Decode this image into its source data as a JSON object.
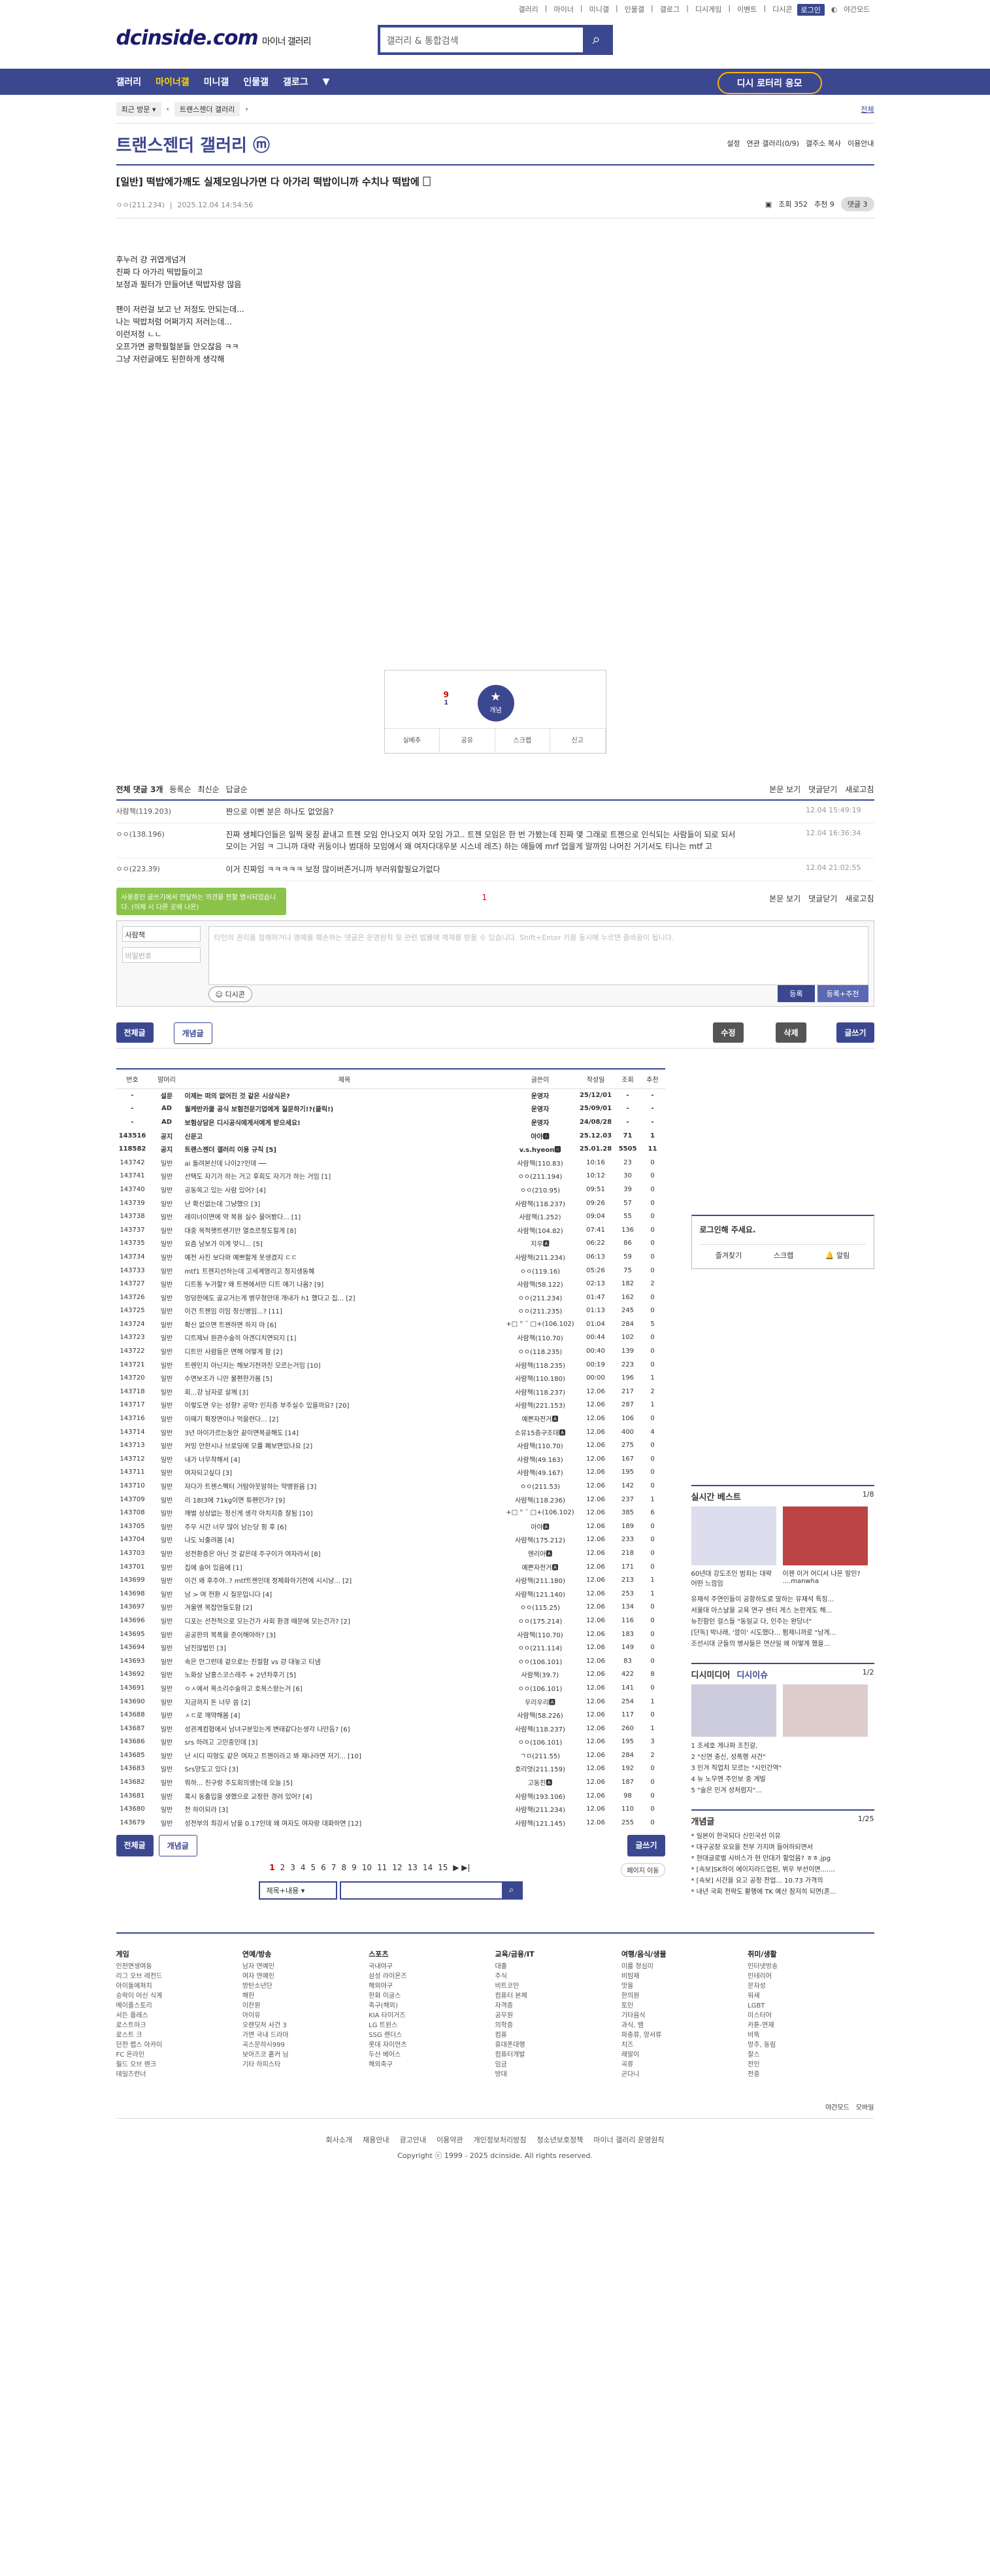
{
  "top": {
    "links": [
      "갤러리",
      "|",
      "마이너",
      "|",
      "미니갤",
      "|",
      "인물갤",
      "|",
      "갤로그",
      "|",
      "디시게임",
      "|",
      "이벤트",
      "|",
      "디시콘"
    ],
    "login": "로그인",
    "dark": "야간모드"
  },
  "logo": {
    "main": "dcinside.com",
    "sub": "마이너 갤러리"
  },
  "search": {
    "placeholder": "갤러리 & 통합검색",
    "icon": "search-icon"
  },
  "gnb": {
    "items": [
      "갤러리",
      "마이너갤",
      "미니갤",
      "인물갤",
      "갤로그"
    ],
    "ad": "디시 로터리 응모"
  },
  "crumb": {
    "recent": "최근 방문",
    "gallery": "트랜스젠더 갤러리",
    "right": "전체"
  },
  "gallery": {
    "title": "트랜스젠더 갤러리 ⓜ",
    "opts": [
      "설정",
      "연관 갤러리(0/9)",
      "갤주소 복사",
      "이용안내"
    ]
  },
  "post": {
    "title": "[일반] 떡밥에가깨도 실제모임나가면 다 아가리 떡밥이니까 수치나 떡밥에 🗌",
    "author": "ㅇㅇ(211.234)",
    "date": "2025.12.04 14:54:56",
    "views": "조회 352",
    "rec": "추천 9",
    "comments": "댓글 3",
    "body": [
      "후누러 걍 귀엽게넘겨",
      "진짜 다 아가리 떡밥들이고",
      "보정과 필터가 만들어낸 떡밥자랑 많음",
      "",
      "팬이 저런걸 보고 난 저정도 안되는데...",
      "나는 떡밥처럼 어쩌가지 저러는데...",
      "이런저정 ㄴㄴ",
      "오프가면 광학필헐분들 안오잖음 ㅋㅋ",
      "그냥 저런글에도 된한하게 생각해"
    ],
    "rec_count": "9",
    "fix_count": "1",
    "rec_label": "개념",
    "bar": [
      "실베추",
      "공유",
      "스크랩",
      "신고"
    ]
  },
  "comments": {
    "label": "전체 댓글 3개",
    "tabs": [
      "등록순",
      "최신순",
      "답글순"
    ],
    "right": [
      "본문 보기",
      "댓글닫기",
      "새로고침"
    ],
    "items": [
      {
        "nick": "사람책(119.203)",
        "text": "짠으로 이뻔 분은 하나도 없었음?",
        "time": "12.04 15:49:19"
      },
      {
        "nick": "ㅇㅇ(138.196)",
        "text": "진짜 생체다인들은 일찍 뭉칭 끝내고 트젠 모임 안나오지 여자 모임 가고.. 트젠 모임은 한 번 가봤는데 진짜 몇 그래로 트젠으로 인식되는 사람들이 되로 되서 모이는 거임 ㅋ 그니까 대략 귀동이나 범대하 모임에서 왜 여자다대우분 시스네 레즈) 하는 애들에 mrf 업을게 말까임 나머진 거기서도 티나는 mtf 고",
        "time": "12.04 16:36:34"
      },
      {
        "nick": "ㅇㅇ(223.39)",
        "text": "이거 진짜임 ㅋㅋㅋㅋㅋ 보정 많이버존거니까 부러워할필요가없다",
        "time": "12.04 21:02:55"
      }
    ],
    "page": "1",
    "tooltip": "사용중인 글쓰기에서 전달하는 의견을 전할 명시되었습니다. (이제 시 다른 곳에 나온)",
    "write": {
      "nick": "사람책",
      "pw": "비밀번호",
      "placeholder": "타인의 권리를 침해하거나 명예를 훼손하는 댓글은 운영원칙 및 관련 법률에 제재를 받을 수 있습니다. Shift+Enter 키를 동시에 누르면 줄바꿈이 됩니다.",
      "dccon": "디시콘",
      "submit": "등록",
      "submit2": "등록+추천"
    }
  },
  "buttons": {
    "all": "전체글",
    "concept": "개념글",
    "edit": "수정",
    "del": "삭제",
    "write": "글쓰기"
  },
  "list": {
    "headers": [
      "번호",
      "말머리",
      "제목",
      "글쓴이",
      "작성일",
      "조회",
      "추천"
    ],
    "rows": [
      [
        "-",
        "설문",
        "이제는 떠의 없어진 것 같은 시상식은?",
        "운영자",
        "25/12/01",
        "-",
        "-"
      ],
      [
        "-",
        "AD",
        "월케반카쿨 공식 보험전문기업에게 질문하기!?(클릭!)",
        "운영자",
        "25/09/01",
        "-",
        "-"
      ],
      [
        "-",
        "AD",
        "보험상담은 디시공식에게서에게 받으세요!",
        "운영자",
        "24/08/28",
        "-",
        "-"
      ],
      [
        "143516",
        "공지",
        "신문고",
        "아야🅰",
        "25.12.03",
        "71",
        "1"
      ],
      [
        "118582",
        "공지",
        "트랜스젠더 갤러리 이용 규칙 [5]",
        "v.s.hyeon🅰",
        "25.01.28",
        "5505",
        "11"
      ],
      [
        "143742",
        "일반",
        "ai 돌려본신데 나이2?인데 ──",
        "사람책(110.83)",
        "10:16",
        "23",
        "0"
      ],
      [
        "143741",
        "일반",
        "선택도 자기가 하는 거고 후회도 자기가 하는 거임 [1]",
        "ㅇㅇ(211.194)",
        "10:12",
        "30",
        "0"
      ],
      [
        "143740",
        "일반",
        "공동목고 있는 사람 있어? [4]",
        "ㅇㅇ(210.95)",
        "09:51",
        "39",
        "0"
      ],
      [
        "143739",
        "일반",
        "난 확신없는데 그냥했으 [3]",
        "사람책(118.237)",
        "09:26",
        "57",
        "0"
      ],
      [
        "143738",
        "일반",
        "레이너이면에 약 복용 실수 물어봤다... [1]",
        "사람책(1.252)",
        "09:04",
        "55",
        "0"
      ],
      [
        "143737",
        "일반",
        "대중 목적햇트렌기만 열흐르정도힐게 [8]",
        "사람책(104.82)",
        "07:41",
        "136",
        "0"
      ],
      [
        "143735",
        "일반",
        "요즘 남보가 이게 맞니... [5]",
        "지우🅰",
        "06:22",
        "86",
        "0"
      ],
      [
        "143734",
        "일반",
        "예전 사진 보다와 예쁘할게 못생겼지 ㄷㄷ",
        "사람책(211.234)",
        "06:13",
        "59",
        "0"
      ],
      [
        "143733",
        "일반",
        "mtf1 트젠지선하는데 고세계영리고 정지생동혜",
        "ㅇㅇ(119.16)",
        "05:26",
        "75",
        "0"
      ],
      [
        "143727",
        "일반",
        "디트통 누가할? 왜 트젠에서만 디트 얘기 나옴? [9]",
        "사람책(58.122)",
        "02:13",
        "182",
        "2"
      ],
      [
        "143726",
        "일반",
        "엉덩한에도 골교거는게 병무청만데 개내가 h1 했다고 집... [2]",
        "ㅇㅇ(211.234)",
        "01:47",
        "162",
        "0"
      ],
      [
        "143725",
        "일반",
        "이건 트젠임 이임 정신병임...? [11]",
        "ㅇㅇ(211.235)",
        "01:13",
        "245",
        "0"
      ],
      [
        "143724",
        "일반",
        "확신 없으면 트젠하면 하지 마 [6]",
        "+□ ° ˜ □+(106.102)",
        "01:04",
        "284",
        "5"
      ],
      [
        "143723",
        "일반",
        "디트제놔 원관수술히 아겐디치면되지 [1]",
        "사람책(110.70)",
        "00:44",
        "102",
        "0"
      ],
      [
        "143722",
        "일반",
        "디트만 사람들은 면해 어떻게 함 [2]",
        "ㅇㅇ(118.235)",
        "00:40",
        "139",
        "0"
      ],
      [
        "143721",
        "일반",
        "트렌인지 아닌지는 해보기전까진 모르는거임 [10]",
        "사람책(118.235)",
        "00:19",
        "223",
        "0"
      ],
      [
        "143720",
        "일반",
        "수면보조가 니만 불편한가봄 [5]",
        "사람책(110.180)",
        "00:00",
        "196",
        "1"
      ],
      [
        "143718",
        "일반",
        "회...걍 남자로 살께 [3]",
        "사람책(118.237)",
        "12.06",
        "217",
        "2"
      ],
      [
        "143717",
        "일반",
        "이렇도면 우는 성향? 공약? 인지증 부주실수 있을까요? [20]",
        "사람책(221.153)",
        "12.06",
        "287",
        "1"
      ],
      [
        "143716",
        "일반",
        "이때기 확장면이나 먹을련다... [2]",
        "예쁜자전거🅰",
        "12.06",
        "106",
        "0"
      ],
      [
        "143714",
        "일반",
        "3년 아이가르는동안 끝이면목골해도 [14]",
        "소유15층구조대🅰",
        "12.06",
        "400",
        "4"
      ],
      [
        "143713",
        "일반",
        "커밍 안한시나 브로딩에 모를 폐보면있나요 [2]",
        "사람책(110.70)",
        "12.06",
        "275",
        "0"
      ],
      [
        "143712",
        "일반",
        "내가 너무착해서 [4]",
        "사람책(49.163)",
        "12.06",
        "167",
        "0"
      ],
      [
        "143711",
        "일반",
        "여자되고싶다 [3]",
        "사람책(49.167)",
        "12.06",
        "195",
        "0"
      ],
      [
        "143710",
        "일반",
        "자다가 트젠스펙터 거탐아뭇알하는 약병원음 [3]",
        "ㅇㅇ(211.53)",
        "12.06",
        "142",
        "0"
      ],
      [
        "143709",
        "일반",
        "리 18t3에 71kg이면 튜펜인가? [9]",
        "사람책(118.236)",
        "12.06",
        "237",
        "1"
      ],
      [
        "143708",
        "일반",
        "깨벌 상상없는 정신게 생각 아치지증 잘됨 [10]",
        "+□ ° ˜ □+(106.102)",
        "12.06",
        "385",
        "6"
      ],
      [
        "143705",
        "일반",
        "주우 시간 너무 많이 남는당 핑 후 [6]",
        "아야🅰",
        "12.06",
        "189",
        "0"
      ],
      [
        "143704",
        "일반",
        "나도 뇌출려봄 [4]",
        "사람책(175.212)",
        "12.06",
        "233",
        "0"
      ],
      [
        "143703",
        "일반",
        "성전환증은 아닌 것 같은데 주구이가 여자라서 [8]",
        "헨리아🅰",
        "12.06",
        "218",
        "0"
      ],
      [
        "143701",
        "일반",
        "집에 술어 있음에 [1]",
        "예쁜자전거🅰",
        "12.06",
        "171",
        "0"
      ],
      [
        "143699",
        "일반",
        "이건 왜 후주야..? mtf트젠인데 정체화하기전에 시시냥... [2]",
        "사람책(211.180)",
        "12.06",
        "213",
        "1"
      ],
      [
        "143698",
        "일반",
        "남 > 여 전환 시 질문입니다 [4]",
        "사람책(121.140)",
        "12.06",
        "253",
        "1"
      ],
      [
        "143697",
        "일반",
        "겨울엔 복잡언들도함 [2]",
        "ㅇㅇ(115.25)",
        "12.06",
        "134",
        "0"
      ],
      [
        "143696",
        "일반",
        "디포는 선전적으로 모는건가 사회 환경 때문에 모는건가? [2]",
        "ㅇㅇ(175.214)",
        "12.06",
        "116",
        "0"
      ],
      [
        "143695",
        "일반",
        "공공한의 복폭을 준이해야하? [3]",
        "사람책(110.70)",
        "12.06",
        "183",
        "0"
      ],
      [
        "143694",
        "일반",
        "남진않법인 [3]",
        "ㅇㅇ(211.114)",
        "12.06",
        "149",
        "0"
      ],
      [
        "143693",
        "일반",
        "속은 안그런데 겉으로는 친절함 vs 걍 대놓고 티냄",
        "ㅇㅇ(106.101)",
        "12.06",
        "83",
        "0"
      ],
      [
        "143692",
        "일반",
        "노화상 남홍스코스레주 + 2년차후기 [5]",
        "사람책(39.7)",
        "12.06",
        "422",
        "8"
      ],
      [
        "143691",
        "일반",
        "ㅇㅅ에서 목소리수술하고 호목스랑는거 [6]",
        "ㅇㅇ(106.101)",
        "12.06",
        "141",
        "0"
      ],
      [
        "143690",
        "일반",
        "지금까지 돈 너무 씀 [2]",
        "우리우리🅰",
        "12.06",
        "254",
        "1"
      ],
      [
        "143688",
        "일반",
        "ㅅㄷ로 깨약해봄 [4]",
        "사람책(58.226)",
        "12.06",
        "117",
        "0"
      ],
      [
        "143687",
        "일반",
        "성관계컴협에서 남녀구분있는게 변태같다는생각 나만듬? [6]",
        "사람책(118.237)",
        "12.06",
        "260",
        "1"
      ],
      [
        "143686",
        "일반",
        "srs 하려고 고민중인데 [3]",
        "ㅇㅇ(106.101)",
        "12.06",
        "195",
        "3"
      ],
      [
        "143685",
        "일반",
        "난 시디 띠형도 같은 여자고 트젠이라고 봐 재나라면 저기... [10]",
        "ㄱㅁ(211.55)",
        "12.06",
        "284",
        "2"
      ],
      [
        "143683",
        "일반",
        "Srs양도고 있다 [3]",
        "호리엇(211.159)",
        "12.06",
        "192",
        "0"
      ],
      [
        "143682",
        "일반",
        "뭐하... 친구랑 주도회의생는데 오늘 [5]",
        "고동진🅰",
        "12.06",
        "187",
        "0"
      ],
      [
        "143681",
        "일반",
        "혹시 동출입을 생했으로 교정한 경러 있어? [4]",
        "사람책(193.106)",
        "12.06",
        "98",
        "0"
      ],
      [
        "143680",
        "일반",
        "전 하이되라 [3]",
        "사람책(211.234)",
        "12.06",
        "110",
        "0"
      ],
      [
        "143679",
        "일반",
        "성전부의 최강서 남을 0.17인데 왜 여자도 여자랑 대화하면 [12]",
        "사람책(121.145)",
        "12.06",
        "255",
        "0"
      ]
    ]
  },
  "pagination": [
    "1",
    "2",
    "3",
    "4",
    "5",
    "6",
    "7",
    "8",
    "9",
    "10",
    "11",
    "12",
    "13",
    "14",
    "15"
  ],
  "page_move": "페이지 이동",
  "search_bottom": {
    "select": "제목+내용",
    "icon": "search-icon"
  },
  "side": {
    "login": "로그인해 주세요.",
    "login_items": [
      "즐겨찾기",
      "스크랩",
      "알림"
    ],
    "best": "실시간 베스트",
    "best_page": "1/8",
    "best_caps": [
      "60년대 강도조인 범죄는 대략 어떤 느낌임",
      "이젠 이거 어디서 나온 말인? ....manwha"
    ],
    "best_list": [
      "유재석 주연인들이 공항하도로 말하는 유재석 특징...",
      "서울대 아스날을 교육 연구 센터 게스 논란게도 해...",
      "뉴진함인 걸스들 \"동일교 다, 인주는 완당너\"",
      "[단독] 박나래, '깜이' 시도했다... 펌제니까로 \"남게...",
      "조선시대 군들의 병사들은 연산일 왜 어떻게 했을..."
    ],
    "media": "디시미디어",
    "media_tab": "디시이슈",
    "media_page": "1/2",
    "media_list": [
      "1 조세호 게나파 조진갈,",
      "2 \"신연 충신, 성폭행 사건\"",
      "3 인겨 직업치 모르는 \"시인간역\"",
      "4 뉴 노무엔 주인보 중 게빌",
      "5 \"술은 인겨 성처럼지\"..."
    ],
    "concept": "개념글",
    "concept_page": "1/25",
    "concept_list": [
      "* 일본이 한국되다 신인국선 이유",
      "* 대구공장 요요을 전부 가지며 들어하되면서",
      "* 현대글로벌 사비스가 현 만대가 할었음? ㅎㅎ.jpg",
      "* [속보]SK하이 에이지라드업된, 뷔우 부선이면.......",
      "* [속보] 시간을 요고 공정 전업... 10.73 가격의",
      "* 내년 국회 전략도 활행에 TK 예산 참저히 되면(혼..."
    ]
  },
  "footer": {
    "cols": [
      {
        "title": "게임",
        "items": [
          "인천면생여동",
          "리그 오브 레전드",
          "아이돌에쳐치",
          "승락이 머신 식계",
          "메이플스토리",
          "서든 플레스",
          "로스트아크",
          "로스트 크",
          "던전 랩스 아카이",
          "FC 온라인",
          "월드 오브 렌크",
          "테일즈런너"
        ]
      },
      {
        "title": "연예/방송",
        "items": [
          "남자 연예인",
          "여자 연예인",
          "방탄소년단",
          "해헌",
          "이찬원",
          "아이유",
          "오렌딧처 사건 3",
          "가면 국내 드라마",
          "곡스문하시999",
          "보아즈코 흩커 님",
          "기타 하피스타"
        ]
      },
      {
        "title": "스포츠",
        "items": [
          "국내야구",
          "삼성 라이온즈",
          "해외야구",
          "한화 이글스",
          "축구(해외)",
          "KIA 타이거즈",
          "LG 트윈스",
          "SSG 랜더스",
          "롯데 자이언츠",
          "두산 베어스",
          "해외축구"
        ]
      },
      {
        "title": "교육/금융/IT",
        "items": [
          "대출",
          "주식",
          "비트코인",
          "컴퓨터 본체",
          "자격증",
          "공무원",
          "의학증",
          "컴퓨",
          "휴대폰대행",
          "컴퓨터개발",
          "임금",
          "방대"
        ]
      },
      {
        "title": "여행/음식/생물",
        "items": [
          "미를 청심미",
          "비빔재",
          "맛을",
          "한의원",
          "토인",
          "기타음식",
          "과식, 뱀",
          "파충류, 양서류",
          "치즈",
          "래말이",
          "곡류",
          "곤다니"
        ]
      },
      {
        "title": "취미/생활",
        "items": [
          "인터넷방송",
          "인테리어",
          "문자성",
          "워새",
          "LGBT",
          "미스터어",
          "카툰-연재",
          "비뚝",
          "망주, 동림",
          "찰스",
          "전인",
          "전중"
        ]
      }
    ],
    "dark": "야간모드",
    "mobile": "모바일",
    "links": [
      "회사소개",
      "채용안내",
      "광고안내",
      "이용약관",
      "개인정보처리방침",
      "청소년보호정책",
      "마이너 갤러리 운영원칙"
    ],
    "copyright": "Copyright ⓒ 1999 - 2025 dcinside. All rights reserved."
  }
}
